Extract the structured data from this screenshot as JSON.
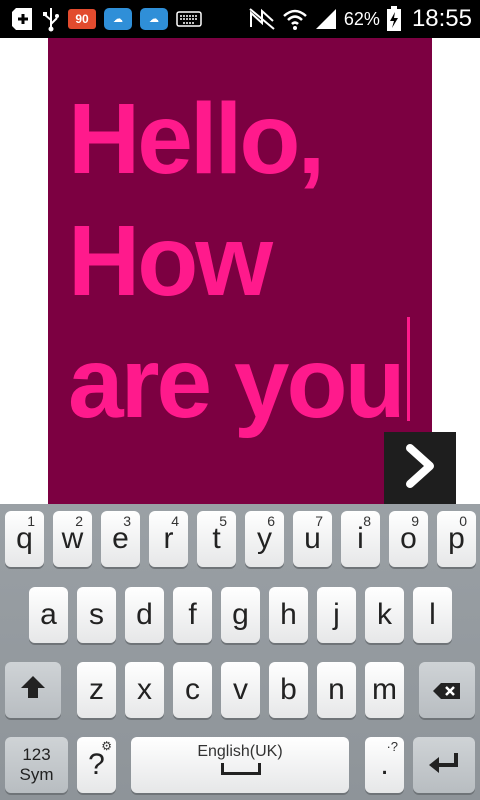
{
  "status_bar": {
    "notification_badge": "90",
    "battery_percent": "62%",
    "time": "18:55",
    "icons": [
      "add-icon",
      "usb-icon",
      "notification-badge-icon",
      "cloud-app-icon",
      "cloud-app-icon",
      "keyboard-icon",
      "mute-icon",
      "wifi-icon",
      "signal-icon",
      "battery-charging-icon"
    ]
  },
  "canvas": {
    "lines": [
      "Hello,",
      "How",
      "are you"
    ],
    "background_color": "#7c0041",
    "text_color": "#ff1a8c"
  },
  "keyboard": {
    "row1": [
      {
        "label": "q",
        "hint": "1"
      },
      {
        "label": "w",
        "hint": "2"
      },
      {
        "label": "e",
        "hint": "3"
      },
      {
        "label": "r",
        "hint": "4"
      },
      {
        "label": "t",
        "hint": "5"
      },
      {
        "label": "y",
        "hint": "6"
      },
      {
        "label": "u",
        "hint": "7"
      },
      {
        "label": "i",
        "hint": "8"
      },
      {
        "label": "o",
        "hint": "9"
      },
      {
        "label": "p",
        "hint": "0"
      }
    ],
    "row2": [
      "a",
      "s",
      "d",
      "f",
      "g",
      "h",
      "j",
      "k",
      "l"
    ],
    "row3": [
      "z",
      "x",
      "c",
      "v",
      "b",
      "n",
      "m"
    ],
    "sym_label_1": "123",
    "sym_label_2": "Sym",
    "question_label": "?",
    "space_label": "English(UK)",
    "period_label": ".",
    "period_hint": "·?"
  }
}
